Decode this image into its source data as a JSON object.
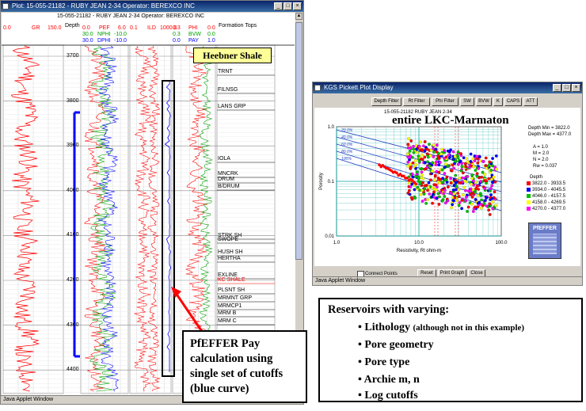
{
  "log_window": {
    "title": "Plot: 15-055-21182 - RUBY JEAN 2-34  Operator: BEREXCO INC",
    "subtitle": "15-055-21182 - RUBY JEAN 2-34  Operator: BEREXCO INC",
    "status": "Java Applet Window",
    "tracks": {
      "gr": {
        "min": "0.0",
        "name": "GR",
        "max": "150.0"
      },
      "depth": "Depth",
      "porosity": [
        {
          "min": "0.0",
          "name": "PEF",
          "max": "6.0",
          "color": "#ff0000"
        },
        {
          "min": "30.0",
          "name": "NPHI",
          "max": "-10.0",
          "color": "#00a000"
        },
        {
          "min": "30.0",
          "name": "DPHI",
          "max": "-10.0",
          "color": "#0000ff"
        }
      ],
      "resistivity": {
        "min": "0.1",
        "name": "ILD",
        "max": "1000.0"
      },
      "pay": [
        {
          "min": "0.3",
          "name": "PHI",
          "max": "0.0",
          "color": "#ff0000"
        },
        {
          "min": "0.3",
          "name": "BVW",
          "max": "0.0",
          "color": "#00a000"
        },
        {
          "min": "0.0",
          "name": "PAY",
          "max": "1.0",
          "color": "#0000ff"
        }
      ],
      "tops_header": "Formation Tops"
    },
    "depths": [
      "3700",
      "3800",
      "3900",
      "4000",
      "4100",
      "4200",
      "4300",
      "4400"
    ],
    "formation_tops": [
      "TRNT",
      "FILNSG",
      "LANS GRP",
      "IOLA",
      "MNCRK",
      "DRUM",
      "B/DRUM",
      "STRK SH",
      "SWOPE",
      "HUSH SH",
      "HERTHA",
      "EXLINE",
      "KC SHALE",
      "PLSNT SH",
      "MRMNT GRP",
      "MRMCP1",
      "MRM B",
      "MRM C"
    ]
  },
  "labels": {
    "heebner": "Heebner Shale",
    "pay_callout": "PfEFFER Pay calculation using single set of cutoffs (blue curve)"
  },
  "pickett_window": {
    "title": "KGS Pickett Plot Display",
    "buttons": [
      "Depth Filter",
      "Rt Filter",
      "Phi Filter",
      "SW",
      "BVW",
      "K",
      "CAPS",
      "ATT"
    ],
    "well": "15-055-21182 RUBY JEAN 2-34",
    "heading": "entire LKC-Marmaton",
    "depth_min": "Depth Min = 3822.0",
    "depth_max": "Depth Max = 4377.0",
    "params": [
      "A = 1.0",
      "M = 2.0",
      "N = 2.0",
      "Rw = 0.037"
    ],
    "legend_title": "Depth",
    "legend": [
      {
        "label": "3822.0 - 3933.5",
        "color": "#ff0000"
      },
      {
        "label": "3934.0 - 4045.5",
        "color": "#0000ff"
      },
      {
        "label": "4046.0 - 4157.5",
        "color": "#00c000"
      },
      {
        "label": "4158.0 - 4269.5",
        "color": "#ffff00"
      },
      {
        "label": "4270.0 - 4377.0",
        "color": "#ff00ff"
      }
    ],
    "x_ticks": [
      "1.0",
      "10.0",
      "100.0"
    ],
    "y_ticks": [
      "1.0",
      "0.1",
      "0.01"
    ],
    "x_label": "Resistivity, Rt  ohm-m",
    "y_label": "Porosity",
    "sw_lines": [
      "20.0%",
      "40.0%",
      "60.0%",
      "80.0%",
      "100%"
    ],
    "connect_points": "Connect Points",
    "bottom_buttons": [
      "Reset",
      "Print Graph",
      "Close"
    ],
    "status": "Java Applet Window",
    "logo": "PfEFFER"
  },
  "reservoir_box": {
    "title": "Reservoirs with varying:",
    "bullets": [
      {
        "text": "• Lithology",
        "note": "(although not in this example)"
      },
      {
        "text": "• Pore geometry"
      },
      {
        "text": "• Pore type"
      },
      {
        "text": "• Archie m, n"
      },
      {
        "text": "• Log cutoffs"
      }
    ]
  }
}
